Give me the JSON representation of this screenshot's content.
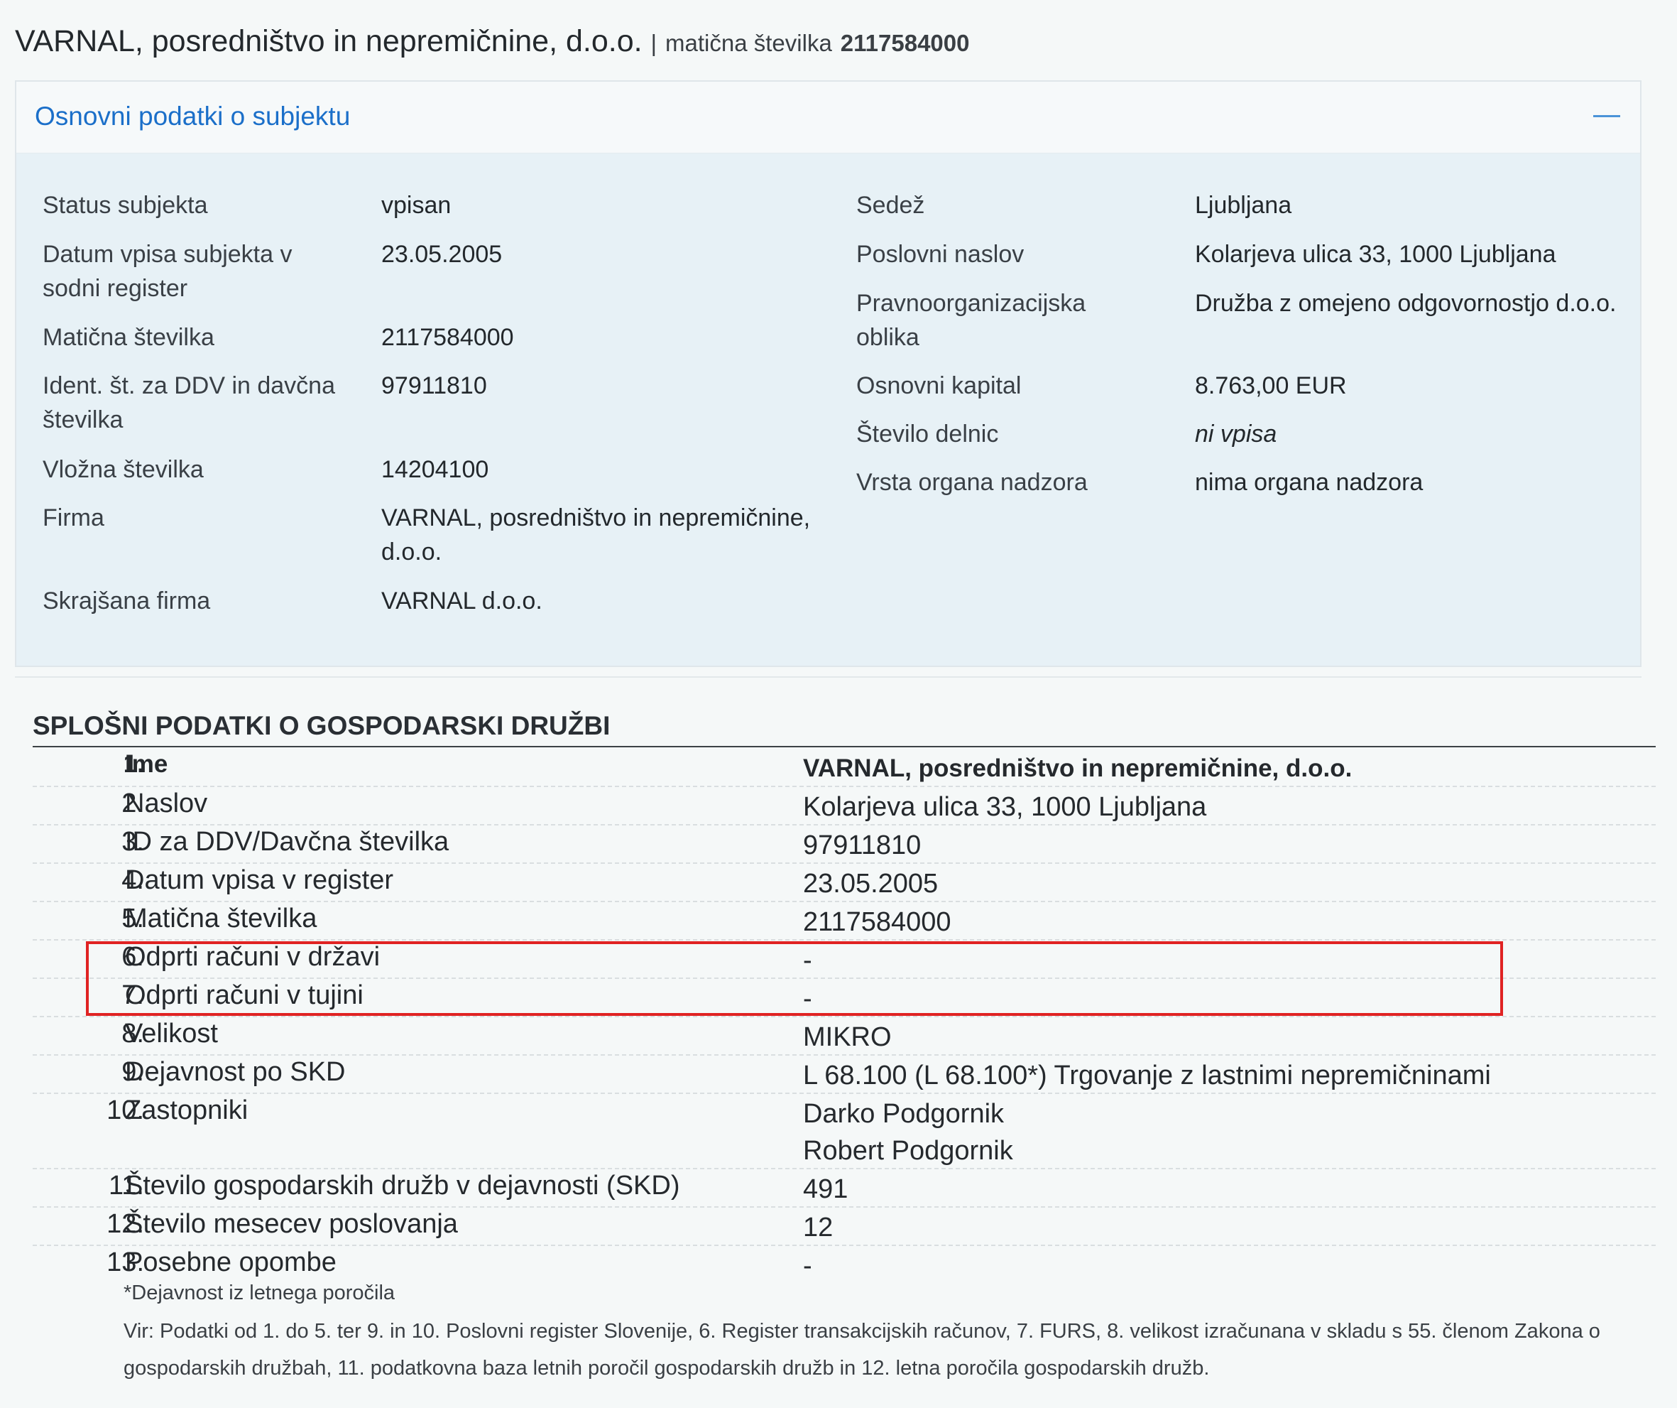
{
  "header": {
    "company_name": "VARNAL, posredništvo in nepremičnine, d.o.o.",
    "separator": "|",
    "reg_label": "matična številka",
    "reg_number": "2117584000"
  },
  "panel": {
    "title": "Osnovni podatki o subjektu",
    "left": [
      {
        "field": "Status subjekta",
        "value": "vpisan"
      },
      {
        "field": "Datum vpisa subjekta v sodni register",
        "value": "23.05.2005"
      },
      {
        "field": "Matična številka",
        "value": "2117584000"
      },
      {
        "field": "Ident. št. za DDV in davčna številka",
        "value": "97911810"
      },
      {
        "field": "Vložna številka",
        "value": "14204100"
      },
      {
        "field": "Firma",
        "value": "VARNAL, posredništvo in nepremičnine, d.o.o."
      },
      {
        "field": "Skrajšana firma",
        "value": "VARNAL d.o.o."
      }
    ],
    "right": [
      {
        "field": "Sedež",
        "value": "Ljubljana"
      },
      {
        "field": "Poslovni naslov",
        "value": "Kolarjeva ulica 33, 1000 Ljubljana"
      },
      {
        "field": "Pravnoorganizacijska oblika",
        "value": "Družba z omejeno odgovornostjo d.o.o."
      },
      {
        "field": "Osnovni kapital",
        "value": "8.763,00 EUR"
      },
      {
        "field": "Število delnic",
        "value": "ni vpisa"
      },
      {
        "field": "Vrsta organa nadzora",
        "value": "nima organa nadzora"
      }
    ]
  },
  "general": {
    "title": "SPLOŠNI PODATKI O GOSPODARSKI DRUŽBI",
    "rows": [
      {
        "num": "1.",
        "label": "Ime",
        "value": "VARNAL, posredništvo in nepremičnine, d.o.o."
      },
      {
        "num": "2.",
        "label": "Naslov",
        "value": "Kolarjeva ulica 33, 1000 Ljubljana"
      },
      {
        "num": "3.",
        "label": "ID za DDV/Davčna številka",
        "value": "97911810"
      },
      {
        "num": "4.",
        "label": "Datum vpisa v register",
        "value": "23.05.2005"
      },
      {
        "num": "5.",
        "label": "Matična številka",
        "value": "2117584000"
      },
      {
        "num": "6.",
        "label": "Odprti računi v državi",
        "value": "-"
      },
      {
        "num": "7.",
        "label": "Odprti računi v tujini",
        "value": "-"
      },
      {
        "num": "8.",
        "label": "Velikost",
        "value": "MIKRO"
      },
      {
        "num": "9.",
        "label": "Dejavnost po SKD",
        "value": "L 68.100 (L 68.100*) Trgovanje z lastnimi nepremičninami"
      },
      {
        "num": "10.",
        "label": "Zastopniki",
        "value": "Darko Podgornik",
        "value2": "Robert Podgornik"
      },
      {
        "num": "11.",
        "label": "Število gospodarskih družb v dejavnosti (SKD)",
        "value": "491"
      },
      {
        "num": "12.",
        "label": "Število mesecev poslovanja",
        "value": "12"
      },
      {
        "num": "13.",
        "label": "Posebne opombe",
        "value": "-"
      }
    ],
    "footnote": "*Dejavnost iz letnega poročila",
    "source": "Vir: Podatki od 1. do 5. ter 9. in 10. Poslovni register Slovenije, 6. Register transakcijskih računov, 7. FURS, 8. velikost izračunana v skladu s 55. členom Zakona o gospodarskih družbah, 11. podatkovna baza letnih poročil gospodarskih družb in 12. letna poročila gospodarskih družb."
  },
  "colors": {
    "accent": "#1b6fc9",
    "panel_bg": "#e7f1f6",
    "highlight": "#e02323"
  }
}
